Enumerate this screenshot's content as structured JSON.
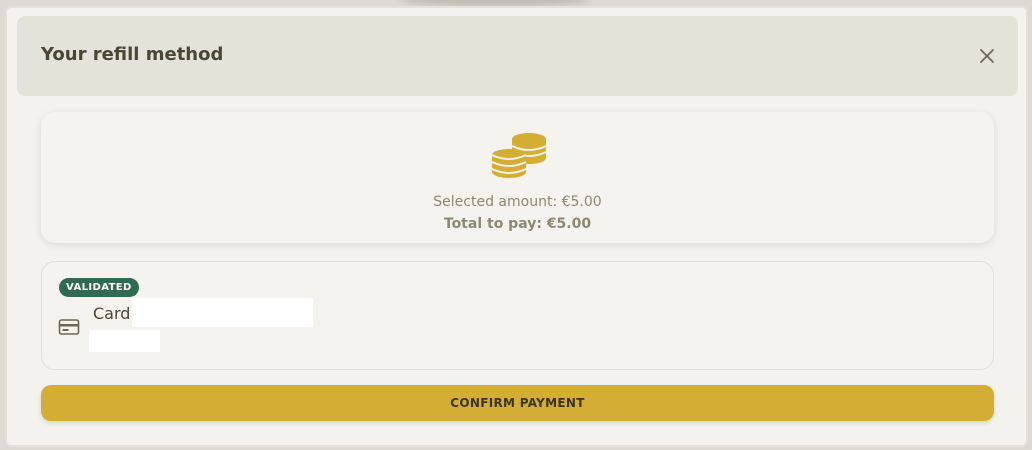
{
  "header": {
    "title": "Your refill method",
    "close_icon": "close-icon"
  },
  "summary": {
    "icon": "coins-icon",
    "selected_amount": "Selected amount: €5.00",
    "total_to_pay": "Total to pay: €5.00"
  },
  "payment_method": {
    "status_badge": "VALIDATED",
    "status_color": "#2e6b52",
    "icon": "credit-card-icon",
    "label": "Card"
  },
  "actions": {
    "confirm_label": "CONFIRM PAYMENT"
  },
  "colors": {
    "accent": "#d4ae34",
    "text_dark": "#4a4636",
    "text_muted": "#8d8874",
    "surface": "#f3f2ed",
    "header_bg": "#e4e3da"
  }
}
